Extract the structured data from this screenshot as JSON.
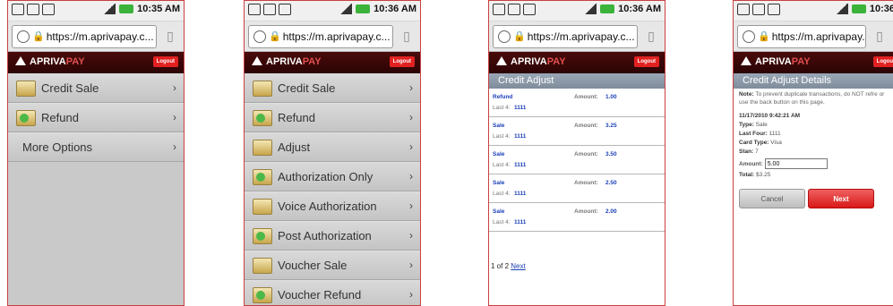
{
  "phones": [
    {
      "time": "10:35 AM",
      "url": "https://m.aprivapay.c...",
      "menu": [
        "Credit Sale",
        "Refund",
        "More Options"
      ]
    },
    {
      "time": "10:36 AM",
      "url": "https://m.aprivapay.c...",
      "menu": [
        "Credit Sale",
        "Refund",
        "Adjust",
        "Authorization Only",
        "Voice Authorization",
        "Post Authorization",
        "Voucher Sale",
        "Voucher Refund"
      ]
    },
    {
      "time": "10:36 AM",
      "url": "https://m.aprivapay.c...",
      "title": "Credit Adjust",
      "transactions": [
        {
          "type": "Refund",
          "amount_label": "Amount:",
          "amount": "1.00",
          "last4_label": "Last 4:",
          "last4": "1111"
        },
        {
          "type": "Sale",
          "amount_label": "Amount:",
          "amount": "3.25",
          "last4_label": "Last 4:",
          "last4": "1111"
        },
        {
          "type": "Sale",
          "amount_label": "Amount:",
          "amount": "3.50",
          "last4_label": "Last 4:",
          "last4": "1111"
        },
        {
          "type": "Sale",
          "amount_label": "Amount:",
          "amount": "2.50",
          "last4_label": "Last 4:",
          "last4": "1111"
        },
        {
          "type": "Sale",
          "amount_label": "Amount:",
          "amount": "2.00",
          "last4_label": "Last 4:",
          "last4": "1111"
        }
      ],
      "pager_text": "1 of 2",
      "pager_link": "Next"
    },
    {
      "time": "10:36",
      "url": "https://m.aprivapay.c...",
      "title": "Credit Adjust Details",
      "note_label": "Note:",
      "note_text": "To prevent duplicate transactions, do NOT refre or use the back button on this page.",
      "datetime": "11/17/2010 9:42:21 AM",
      "type_label": "Type:",
      "type_value": "Sale",
      "last_four_label": "Last Four:",
      "last_four_value": "1111",
      "card_type_label": "Card Type:",
      "card_type_value": "Visa",
      "stan_label": "Stan:",
      "stan_value": "7",
      "amount_label": "Amount:",
      "amount_value": "5.00",
      "total_label": "Total:",
      "total_value": "$3.25",
      "cancel_label": "Cancel",
      "next_label": "Next"
    }
  ],
  "header": {
    "brand_main": "APRIVA",
    "brand_accent": "PAY",
    "logout_label": "Logout"
  },
  "colors": {
    "header_bg": "#3a0707",
    "accent_red": "#e12020",
    "link_blue": "#1a3fb8",
    "battery_green": "#3bb33b"
  }
}
